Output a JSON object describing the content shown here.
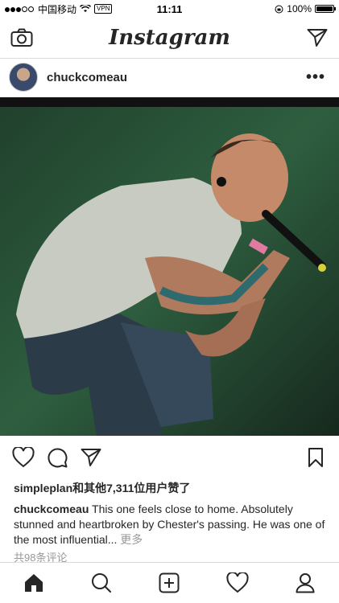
{
  "status": {
    "carrier": "中国移动",
    "vpn": "VPN",
    "time": "11:11",
    "battery": "100%"
  },
  "header": {
    "logo": "Instagram"
  },
  "post": {
    "username": "chuckcomeau",
    "more": "•••",
    "likes": "simpleplan和其他7,311位用户赞了",
    "caption_user": "chuckcomeau",
    "caption_text": " This one feels close to home. Absolutely stunned and heartbroken by Chester's passing. He was one of the most influential...",
    "caption_more": " 更多",
    "comments": "共98条评论"
  },
  "icons": {
    "camera": "camera-icon",
    "direct": "send-icon",
    "like": "heart-icon",
    "comment": "comment-icon",
    "share": "send-icon",
    "save": "bookmark-icon",
    "home": "home-icon",
    "search": "search-icon",
    "add": "add-post-icon",
    "activity": "heart-icon",
    "profile": "profile-icon"
  }
}
